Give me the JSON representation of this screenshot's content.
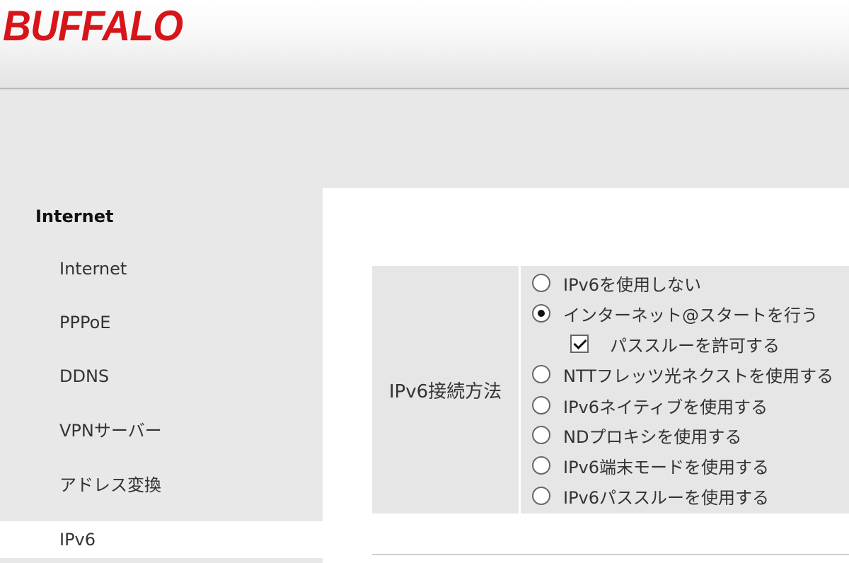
{
  "header": {
    "logo_text": "BUFFALO",
    "logo_color": "#d7141a"
  },
  "sidebar": {
    "heading": "Internet",
    "items": [
      {
        "label": "Internet",
        "active": false
      },
      {
        "label": "PPPoE",
        "active": false
      },
      {
        "label": "DDNS",
        "active": false
      },
      {
        "label": "VPNサーバー",
        "active": false
      },
      {
        "label": "アドレス変換",
        "active": false
      },
      {
        "label": "IPv6",
        "active": true
      }
    ]
  },
  "settings": {
    "ipv6_method_label": "IPv6接続方法",
    "options": {
      "disable": {
        "label": "IPv6を使用しない",
        "checked": false
      },
      "internet_start": {
        "label": "インターネット@スタートを行う",
        "checked": true
      },
      "passthrough_allow": {
        "label": "パススルーを許可する",
        "checked": true
      },
      "ntt_flets_next": {
        "label": "NTTフレッツ光ネクストを使用する",
        "checked": false
      },
      "ipv6_native": {
        "label": "IPv6ネイティブを使用する",
        "checked": false
      },
      "nd_proxy": {
        "label": "NDプロキシを使用する",
        "checked": false
      },
      "ipv6_terminal_mode": {
        "label": "IPv6端末モードを使用する",
        "checked": false
      },
      "ipv6_passthrough": {
        "label": "IPv6パススルーを使用する",
        "checked": false
      }
    }
  }
}
